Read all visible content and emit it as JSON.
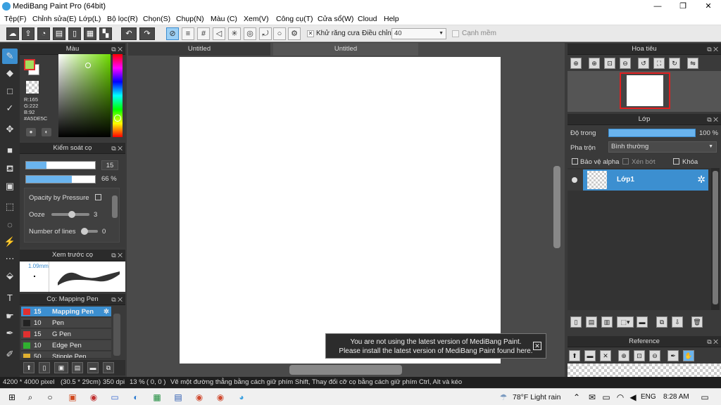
{
  "window": {
    "title": "MediBang Paint Pro (64bit)",
    "minimize": "—",
    "maximize": "❐",
    "close": "✕"
  },
  "menu": [
    "Tệp(F)",
    "Chỉnh sửa(E)",
    "Lớp(L)",
    "Bộ lọc(R)",
    "Chọn(S)",
    "Chụp(N)",
    "Màu (C)",
    "Xem(V)",
    "Công cụ(T)",
    "Cửa sổ(W)",
    "Cloud",
    "Help"
  ],
  "toolbar": {
    "antialias_label": "Khử răng cưa",
    "correction_label": "Điều chỉnh",
    "correction_value": "40",
    "soft_edge_label": "Cạnh mềm"
  },
  "color_panel": {
    "title": "Màu",
    "r": "R:165",
    "g": "G:222",
    "b": "B:92",
    "hex": "#A5DE5C",
    "fg_color": "#A5DE5C",
    "bg_color": "#FFFFFF"
  },
  "brush_control": {
    "title": "Kiểm soát cọ",
    "size_value": "15",
    "opacity_value": "66 %",
    "size_fraction": 0.2,
    "opacity_fraction": 0.66,
    "opacity_pressure_label": "Opacity by Pressure",
    "ooze_label": "Ooze",
    "ooze_value": "3",
    "lines_label": "Number of lines",
    "lines_value": "0"
  },
  "brush_preview": {
    "title": "Xem trước cọ",
    "size": "1.09mm"
  },
  "brush_list": {
    "title": "Cọ: Mapping Pen",
    "items": [
      {
        "size": "15",
        "name": "Mapping Pen",
        "color": "#e03030",
        "selected": true
      },
      {
        "size": "10",
        "name": "Pen",
        "color": "#222222",
        "selected": false
      },
      {
        "size": "15",
        "name": "G Pen",
        "color": "#e03030",
        "selected": false
      },
      {
        "size": "10",
        "name": "Edge Pen",
        "color": "#30b030",
        "selected": false
      },
      {
        "size": "50",
        "name": "Stipple Pen",
        "color": "#e0b030",
        "selected": false
      }
    ]
  },
  "tabs": [
    "Untitled",
    "Untitled"
  ],
  "toast": {
    "line1": "You are not using the latest version of MediBang Paint.",
    "line2": "Please install the latest version of MediBang Paint found here."
  },
  "navigator": {
    "title": "Hoa tiêu"
  },
  "layer_panel": {
    "title": "Lớp",
    "opacity_label": "Độ trong",
    "opacity_value": "100 %",
    "blend_label": "Pha trộn",
    "blend_value": "Bình thường",
    "protect_alpha_label": "Bảo vệ alpha",
    "clip_label": "Xén bớt",
    "lock_label": "Khóa",
    "layer_name": "Lớp1"
  },
  "reference": {
    "title": "Reference"
  },
  "status": {
    "size": "4200 * 4000 pixel",
    "cm": "(30.5 * 29cm)",
    "dpi": "350 dpi",
    "zoom": "13 %",
    "coord": "( 0, 0 )",
    "hint": "Vẽ một đường thẳng bằng cách giữ phím Shift, Thay đổi cỡ cọ bằng cách giữ phím Ctrl, Alt và kéo"
  },
  "taskbar": {
    "weather": "78°F  Light rain",
    "lang": "ENG",
    "time": "8:28 AM"
  }
}
